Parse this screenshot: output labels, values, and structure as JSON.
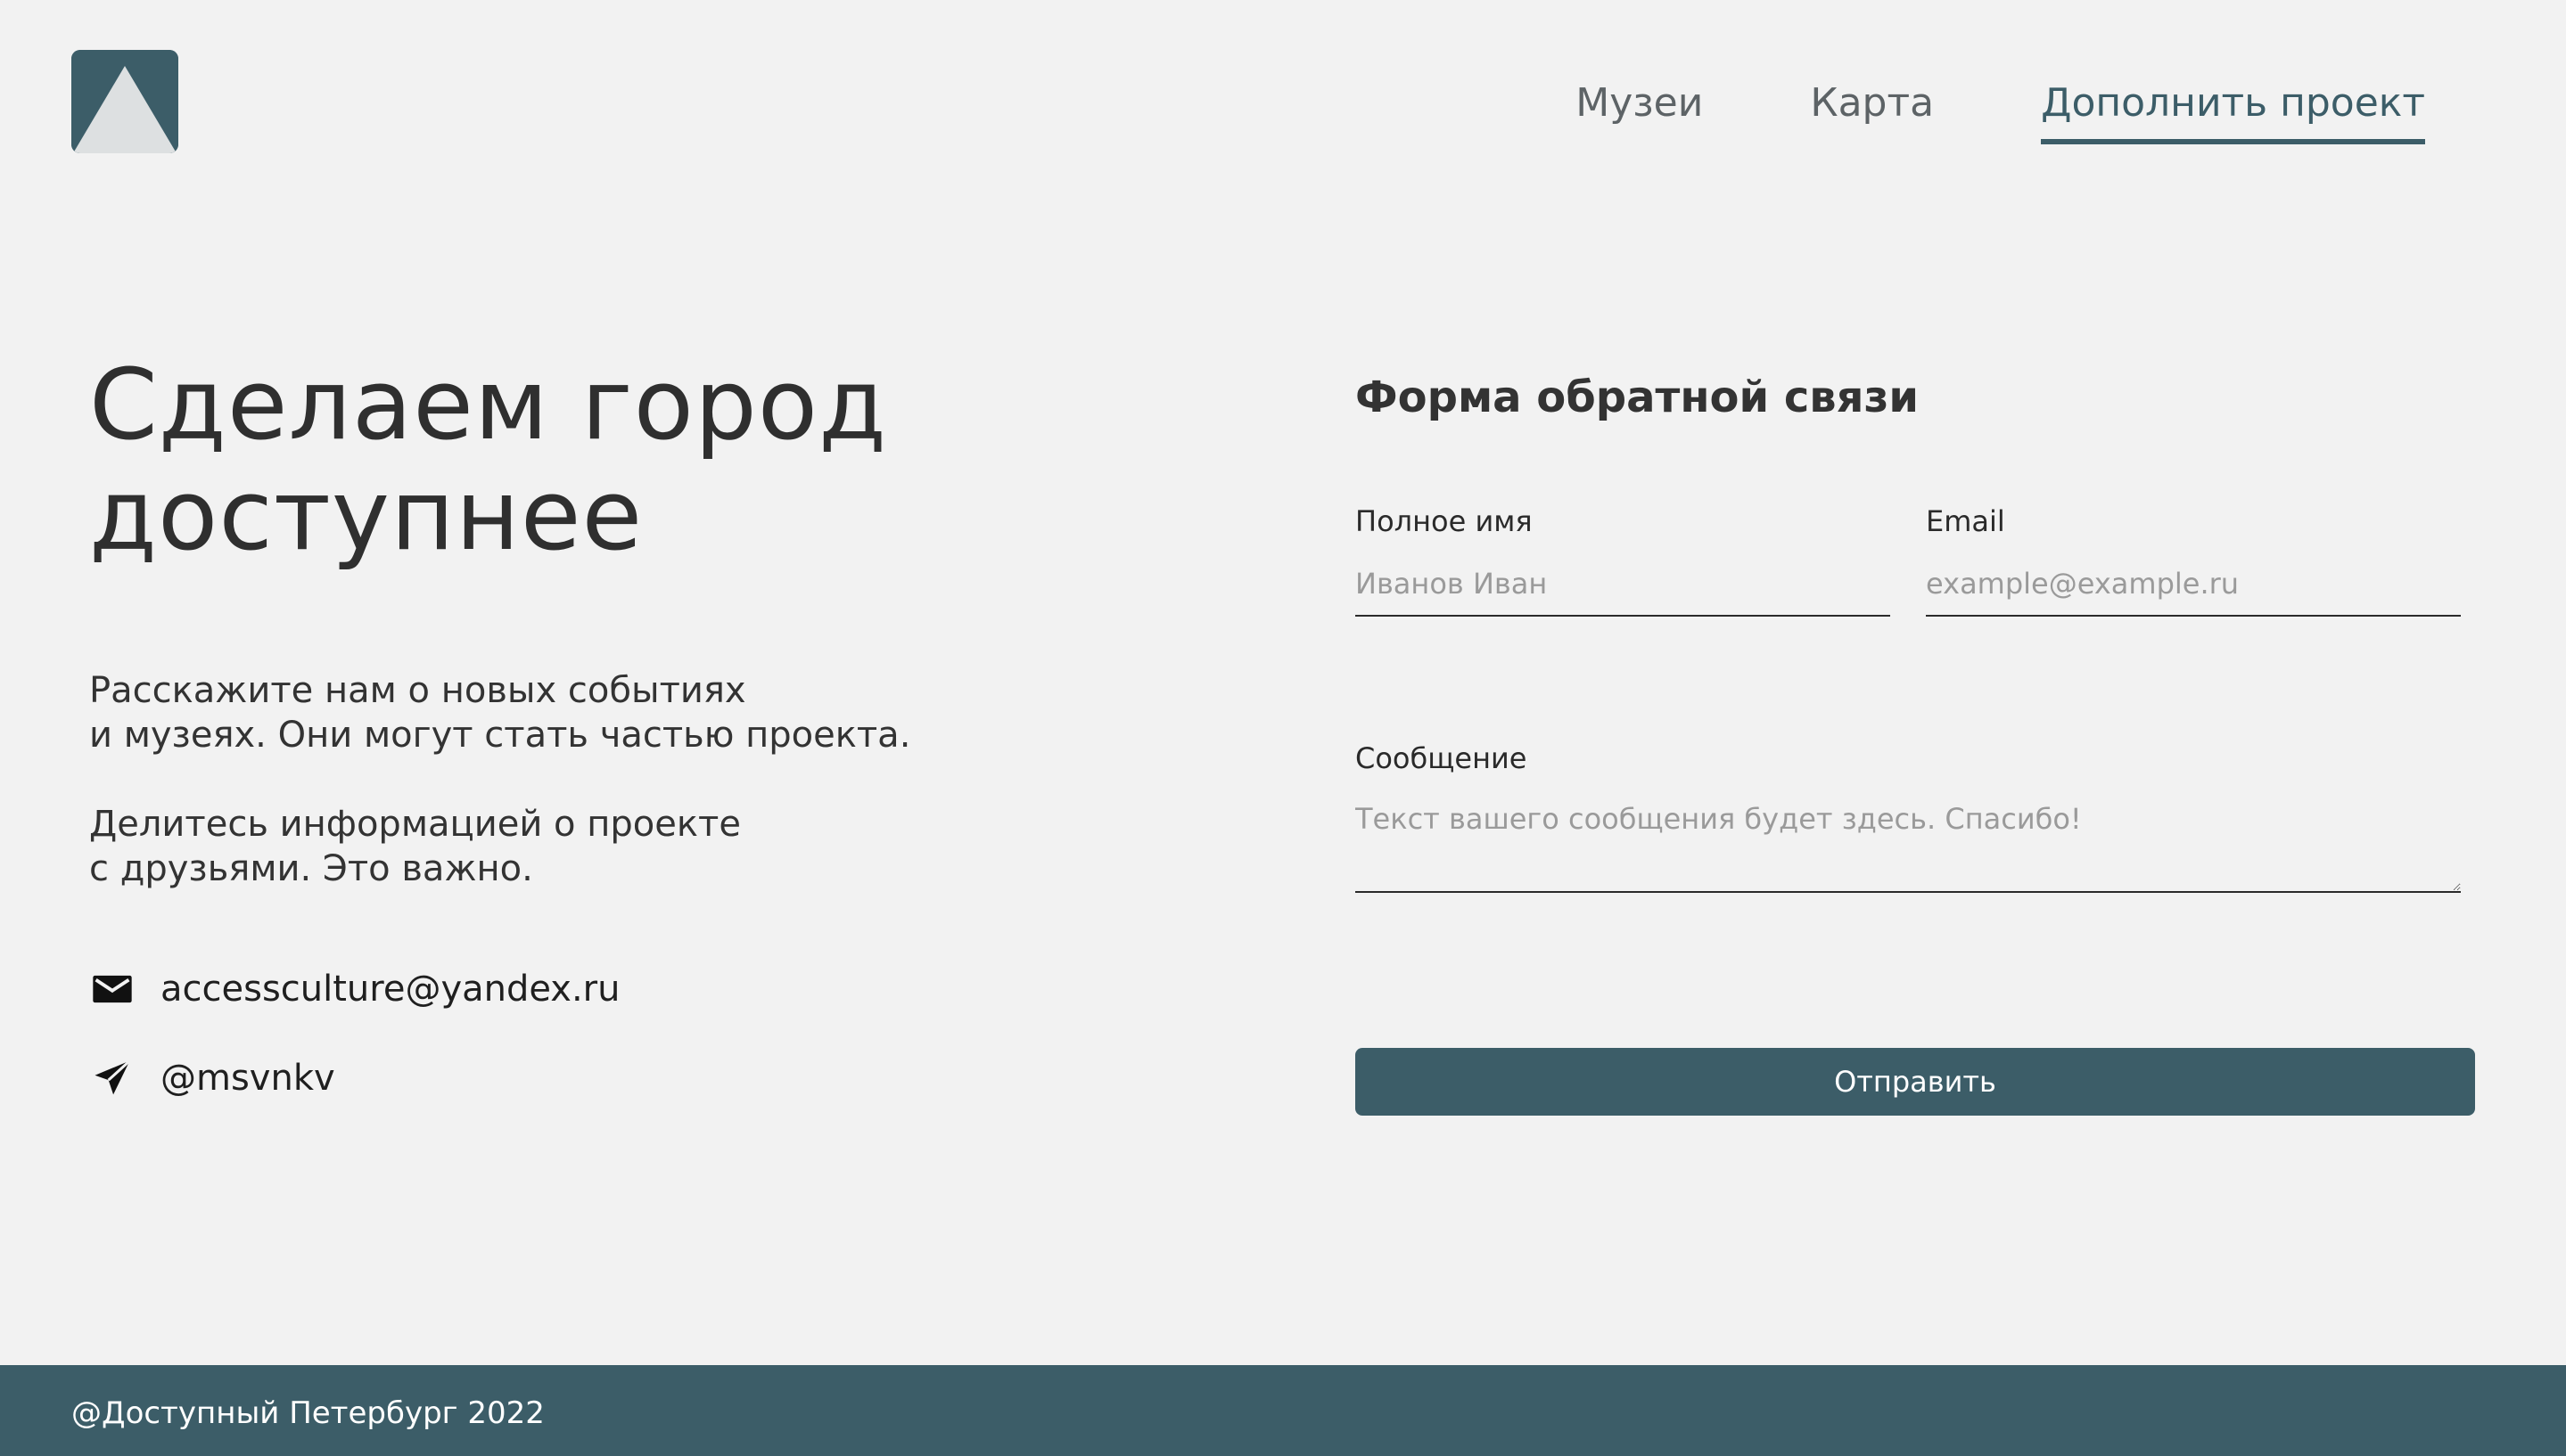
{
  "header": {
    "logo": {
      "icon": "mountain-logo-icon",
      "colors": {
        "background": "#3c5d68",
        "shape": "#dde0e1"
      }
    },
    "nav": [
      {
        "label": "Музеи",
        "active": false
      },
      {
        "label": "Карта",
        "active": false
      },
      {
        "label": "Дополнить проект",
        "active": true
      }
    ]
  },
  "hero": {
    "title": "Сделаем город\nдоступнее",
    "paragraph_1": "Расскажите нам о новых событиях\nи музеях. Они могут стать частью проекта.",
    "paragraph_2": "Делитесь информацией о проекте\nс  друзьями. Это важно.",
    "contacts": {
      "email": {
        "icon": "envelope-icon",
        "text": "accessculture@yandex.ru"
      },
      "telegram": {
        "icon": "paper-plane-icon",
        "text": "@msvnkv"
      }
    }
  },
  "form": {
    "title": "Форма обратной связи",
    "name": {
      "label": "Полное имя",
      "placeholder": "Иванов Иван",
      "value": ""
    },
    "email": {
      "label": "Email",
      "placeholder": "example@example.ru",
      "value": ""
    },
    "message": {
      "label": "Сообщение",
      "placeholder": "Текст вашего сообщения будет здесь. Спасибо!",
      "value": ""
    },
    "submit_label": "Отправить"
  },
  "footer": {
    "text": "@Доступный Петербург 2022"
  },
  "colors": {
    "accent": "#3c5d68",
    "background": "#f2f2f2",
    "text": "#333333"
  }
}
